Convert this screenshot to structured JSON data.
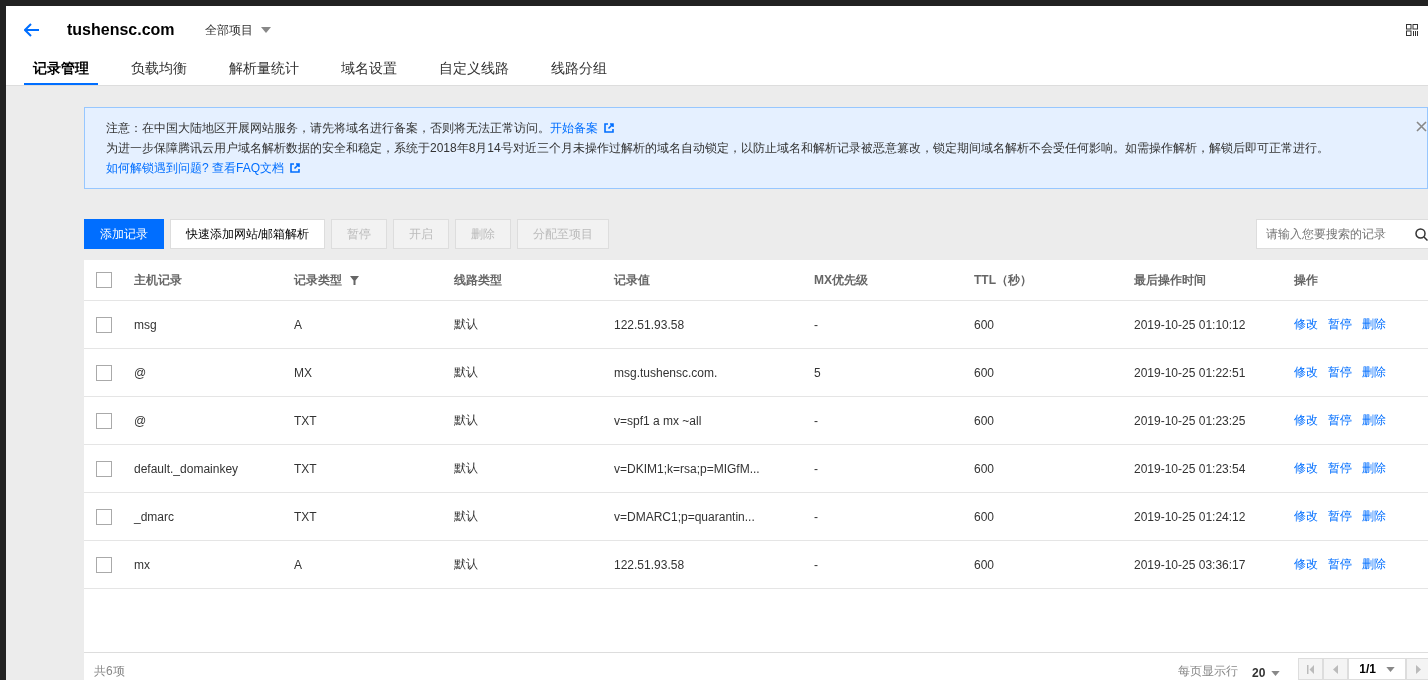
{
  "header": {
    "domain": "tushensc.com",
    "project_selector": "全部项目"
  },
  "tabs": [
    {
      "label": "记录管理",
      "selected": true
    },
    {
      "label": "负载均衡",
      "selected": false
    },
    {
      "label": "解析量统计",
      "selected": false
    },
    {
      "label": "域名设置",
      "selected": false
    },
    {
      "label": "自定义线路",
      "selected": false
    },
    {
      "label": "线路分组",
      "selected": false
    }
  ],
  "notice": {
    "line_1": "注意：在中国大陆地区开展网站服务，请先将域名进行备案，否则将无法正常访问。",
    "line_1_link": "开始备案",
    "line_2": "为进一步保障腾讯云用户域名解析数据的安全和稳定，系统于2018年8月14号对近三个月未操作过解析的域名自动锁定，以防止域名和解析记录被恶意篡改，锁定期间域名解析不会受任何影响。如需操作解析，解锁后即可正常进行。",
    "line_2_link": "如何解锁遇到问题?",
    "faq_link": "查看FAQ文档"
  },
  "toolbar": [
    {
      "label": "添加记录",
      "kind": "primary",
      "disabled": false
    },
    {
      "label": "快速添加网站/邮箱解析",
      "kind": "default",
      "disabled": false
    },
    {
      "label": "暂停",
      "kind": "default",
      "disabled": true
    },
    {
      "label": "开启",
      "kind": "default",
      "disabled": true
    },
    {
      "label": "删除",
      "kind": "default",
      "disabled": true
    },
    {
      "label": "分配至项目",
      "kind": "default",
      "disabled": true
    }
  ],
  "search": {
    "placeholder": "请输入您要搜索的记录"
  },
  "table": {
    "select_all_checked": false,
    "columns": [
      {
        "label": "主机记录",
        "filter": false
      },
      {
        "label": "记录类型",
        "filter": true
      },
      {
        "label": "线路类型",
        "filter": false
      },
      {
        "label": "记录值",
        "filter": false
      },
      {
        "label": "MX优先级",
        "filter": false
      },
      {
        "label": "TTL（秒）",
        "filter": false
      },
      {
        "label": "最后操作时间",
        "filter": false
      },
      {
        "label": "操作",
        "filter": false
      }
    ],
    "rows": [
      {
        "checked": false,
        "cells": [
          "msg",
          "A",
          "默认",
          "122.51.93.58",
          "-",
          "600",
          "2019-10-25 01:10:12"
        ],
        "actions": [
          "修改",
          "暂停",
          "删除"
        ]
      },
      {
        "checked": false,
        "cells": [
          "@",
          "MX",
          "默认",
          "msg.tushensc.com.",
          "5",
          "600",
          "2019-10-25 01:22:51"
        ],
        "actions": [
          "修改",
          "暂停",
          "删除"
        ]
      },
      {
        "checked": false,
        "cells": [
          "@",
          "TXT",
          "默认",
          "v=spf1 a mx ~all",
          "-",
          "600",
          "2019-10-25 01:23:25"
        ],
        "actions": [
          "修改",
          "暂停",
          "删除"
        ]
      },
      {
        "checked": false,
        "cells": [
          "default._domainkey",
          "TXT",
          "默认",
          "v=DKIM1;k=rsa;p=MIGfM...",
          "-",
          "600",
          "2019-10-25 01:23:54"
        ],
        "actions": [
          "修改",
          "暂停",
          "删除"
        ]
      },
      {
        "checked": false,
        "cells": [
          "_dmarc",
          "TXT",
          "默认",
          "v=DMARC1;p=quarantin...",
          "-",
          "600",
          "2019-10-25 01:24:12"
        ],
        "actions": [
          "修改",
          "暂停",
          "删除"
        ]
      },
      {
        "checked": false,
        "cells": [
          "mx",
          "A",
          "默认",
          "122.51.93.58",
          "-",
          "600",
          "2019-10-25 03:36:17"
        ],
        "actions": [
          "修改",
          "暂停",
          "删除"
        ]
      }
    ]
  },
  "footer": {
    "total": "共6项",
    "page_size_label": "每页显示行",
    "page_size": "20",
    "page": "1/1"
  }
}
